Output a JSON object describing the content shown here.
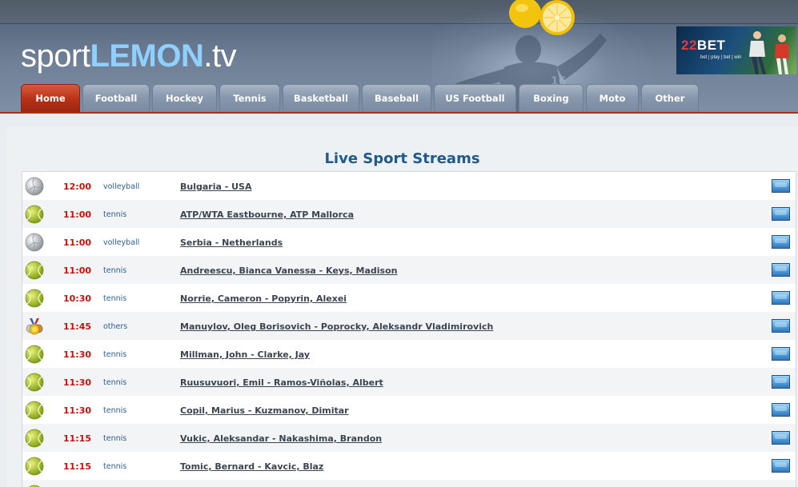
{
  "header": {
    "logo_part1": "sport",
    "logo_part2": "LEMON",
    "logo_part3": ".tv",
    "banner": {
      "brand_num": "22",
      "brand_text": "BET",
      "slogan": "bet | play | bet | win"
    }
  },
  "nav": {
    "tabs": [
      {
        "label": "Home",
        "active": true
      },
      {
        "label": "Football",
        "active": false
      },
      {
        "label": "Hockey",
        "active": false
      },
      {
        "label": "Tennis",
        "active": false
      },
      {
        "label": "Basketball",
        "active": false
      },
      {
        "label": "Baseball",
        "active": false
      },
      {
        "label": "US Football",
        "active": false
      },
      {
        "label": "Boxing",
        "active": false
      },
      {
        "label": "Moto",
        "active": false
      },
      {
        "label": "Other",
        "active": false
      }
    ]
  },
  "main": {
    "title": "Live Sport Streams",
    "events": [
      {
        "icon": "volleyball-icon",
        "time": "12:00",
        "sport": "volleyball",
        "match": "Bulgaria - USA"
      },
      {
        "icon": "tennis-ball-icon",
        "time": "11:00",
        "sport": "tennis",
        "match": "ATP/WTA Eastbourne, ATP Mallorca"
      },
      {
        "icon": "volleyball-icon",
        "time": "11:00",
        "sport": "volleyball",
        "match": "Serbia - Netherlands"
      },
      {
        "icon": "tennis-ball-icon",
        "time": "11:00",
        "sport": "tennis",
        "match": "Andreescu, Bianca Vanessa - Keys, Madison"
      },
      {
        "icon": "tennis-ball-icon",
        "time": "10:30",
        "sport": "tennis",
        "match": "Norrie, Cameron - Popyrin, Alexei"
      },
      {
        "icon": "medals-icon",
        "time": "11:45",
        "sport": "others",
        "match": "Manuylov, Oleg Borisovich - Poprocky, Aleksandr Vladimirovich"
      },
      {
        "icon": "tennis-ball-icon",
        "time": "11:30",
        "sport": "tennis",
        "match": "Millman, John - Clarke, Jay"
      },
      {
        "icon": "tennis-ball-icon",
        "time": "11:30",
        "sport": "tennis",
        "match": "Ruusuvuori, Emil - Ramos-Viñolas, Albert"
      },
      {
        "icon": "tennis-ball-icon",
        "time": "11:30",
        "sport": "tennis",
        "match": "Copil, Marius - Kuzmanov, Dimitar"
      },
      {
        "icon": "tennis-ball-icon",
        "time": "11:15",
        "sport": "tennis",
        "match": "Vukic, Aleksandar - Nakashima, Brandon"
      },
      {
        "icon": "tennis-ball-icon",
        "time": "11:15",
        "sport": "tennis",
        "match": "Tomic, Bernard - Kavcic, Blaz"
      },
      {
        "icon": "tennis-ball-icon",
        "time": "",
        "sport": "",
        "match": ""
      }
    ]
  },
  "colors": {
    "accent_red": "#c4130e",
    "title_blue": "#1f5a8a",
    "active_tab": "#b63117"
  }
}
